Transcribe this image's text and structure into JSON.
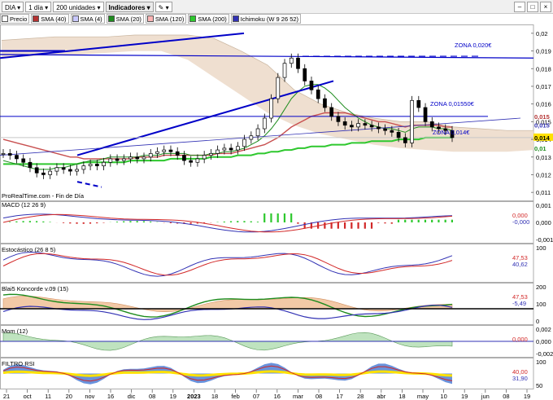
{
  "toolbar": {
    "symbol": "DIA",
    "period": "1 día",
    "units": "200 unidades",
    "indicators_label": "Indicadores"
  },
  "legend": [
    {
      "label": "Precio",
      "color": "#ffffff"
    },
    {
      "label": "SMA (40)",
      "color": "#b43232"
    },
    {
      "label": "SMA (4)",
      "color": "#c8c8ff"
    },
    {
      "label": "SMA (20)",
      "color": "#1e8c1e"
    },
    {
      "label": "SMA (120)",
      "color": "#ffb4b4"
    },
    {
      "label": "SMA (200)",
      "color": "#2ec82e"
    },
    {
      "label": "Ichimoku (W 9 26 52)",
      "color": "#3232b4"
    }
  ],
  "source_label": "ProRealTime.com - Fin de Día",
  "annotations": {
    "zone_020": "ZONA 0,020€",
    "zone_01550": "ZONA 0,01550€",
    "zone_014": "ZONA 0,014€"
  },
  "chart_data": {
    "type": "candlestick",
    "ylim": [
      0.0105,
      0.0205
    ],
    "y_ticks": [
      "0,02",
      "0,019",
      "0,018",
      "0,017",
      "0,016",
      "0,015",
      "0,014",
      "0,013",
      "0,012",
      "0,011"
    ],
    "right_labels": [
      {
        "text": "0,015",
        "value": 0.0153,
        "color": "#b43232"
      },
      {
        "text": "0,015",
        "value": 0.0148,
        "color": "#3232b4"
      },
      {
        "text": "0,014",
        "value": 0.0141,
        "color": "#000000",
        "bg": "#ffe100"
      },
      {
        "text": "0,01",
        "value": 0.0135,
        "color": "#1e8c1e"
      }
    ],
    "x_ticks": [
      "21",
      "oct",
      "11",
      "20",
      "nov",
      "16",
      "dic",
      "08",
      "19",
      "2023",
      "18",
      "feb",
      "07",
      "16",
      "mar",
      "08",
      "17",
      "28",
      "abr",
      "18",
      "may",
      "10",
      "19",
      "jun",
      "08",
      "19"
    ],
    "x_tick_bold": [
      "2023"
    ],
    "close_prices": [
      0.0132,
      0.0131,
      0.0129,
      0.0127,
      0.0124,
      0.0121,
      0.012,
      0.0122,
      0.0124,
      0.0123,
      0.0122,
      0.0123,
      0.0125,
      0.0126,
      0.0125,
      0.0127,
      0.0129,
      0.0128,
      0.0129,
      0.013,
      0.0129,
      0.013,
      0.0132,
      0.0133,
      0.0134,
      0.0133,
      0.0131,
      0.0128,
      0.0127,
      0.0129,
      0.0131,
      0.0132,
      0.0134,
      0.0135,
      0.0134,
      0.0136,
      0.014,
      0.0142,
      0.0146,
      0.0152,
      0.0163,
      0.0175,
      0.0183,
      0.0186,
      0.018,
      0.0173,
      0.0168,
      0.0163,
      0.0158,
      0.0153,
      0.015,
      0.0148,
      0.0147,
      0.0149,
      0.0148,
      0.0147,
      0.0146,
      0.0145,
      0.0144,
      0.0141,
      0.0138,
      0.0162,
      0.0158,
      0.015,
      0.0147,
      0.0146,
      0.0145,
      0.0141
    ],
    "sma20": [
      0.0128,
      0.0127,
      0.0126,
      0.0125,
      0.0124,
      0.0123,
      0.0123,
      0.0123,
      0.0124,
      0.0124,
      0.0125,
      0.0126,
      0.0127,
      0.0128,
      0.0128,
      0.0129,
      0.013,
      0.013,
      0.013,
      0.013,
      0.013,
      0.0131,
      0.0131,
      0.0131,
      0.0132,
      0.0132,
      0.0132,
      0.0132,
      0.0131,
      0.0131,
      0.0131,
      0.0132,
      0.0132,
      0.0133,
      0.0133,
      0.0134,
      0.0135,
      0.0137,
      0.0139,
      0.0142,
      0.0146,
      0.0151,
      0.0157,
      0.0163,
      0.0167,
      0.017,
      0.0171,
      0.0171,
      0.0169,
      0.0166,
      0.0162,
      0.0158,
      0.0155,
      0.0152,
      0.015,
      0.0148,
      0.0147,
      0.0146,
      0.0146,
      0.0145,
      0.0144,
      0.0146,
      0.0147,
      0.0147,
      0.0147,
      0.0146,
      0.0146,
      0.0145
    ],
    "sma40": [
      0.014,
      0.0139,
      0.0138,
      0.0137,
      0.0136,
      0.0135,
      0.0134,
      0.0133,
      0.0132,
      0.0131,
      0.013,
      0.013,
      0.0129,
      0.0129,
      0.0129,
      0.0129,
      0.0129,
      0.0129,
      0.0129,
      0.0129,
      0.013,
      0.013,
      0.013,
      0.013,
      0.0131,
      0.0131,
      0.0131,
      0.0131,
      0.0131,
      0.0131,
      0.0131,
      0.0131,
      0.0132,
      0.0132,
      0.0132,
      0.0133,
      0.0134,
      0.0135,
      0.0136,
      0.0137,
      0.0139,
      0.0141,
      0.0144,
      0.0147,
      0.0149,
      0.0151,
      0.0153,
      0.0154,
      0.0155,
      0.0155,
      0.0155,
      0.0155,
      0.0154,
      0.0153,
      0.0152,
      0.0151,
      0.015,
      0.015,
      0.0149,
      0.0148,
      0.0147,
      0.0148,
      0.0148,
      0.0148,
      0.0148,
      0.0148,
      0.0147,
      0.0147
    ],
    "sma200": [
      0.0126,
      0.0126,
      0.0126,
      0.0126,
      0.0126,
      0.0126,
      0.0126,
      0.0126,
      0.0126,
      0.0126,
      0.0126,
      0.0126,
      0.0127,
      0.0127,
      0.0127,
      0.0127,
      0.0127,
      0.0127,
      0.0127,
      0.0128,
      0.0128,
      0.0128,
      0.0128,
      0.0128,
      0.0128,
      0.0129,
      0.0129,
      0.0129,
      0.0129,
      0.0129,
      0.0129,
      0.013,
      0.013,
      0.013,
      0.013,
      0.0131,
      0.0131,
      0.0131,
      0.0132,
      0.0132,
      0.0133,
      0.0133,
      0.0134,
      0.0134,
      0.0135,
      0.0135,
      0.0136,
      0.0136,
      0.0136,
      0.0137,
      0.0137,
      0.0137,
      0.0138,
      0.0138,
      0.0138,
      0.0139,
      0.0139,
      0.0139,
      0.0139,
      0.014,
      0.014,
      0.014,
      0.014,
      0.0141,
      0.0141,
      0.0141,
      0.0141,
      0.0141
    ],
    "indicators": [
      {
        "name": "MACD (12 26 9)",
        "ticks": [
          "0,001",
          "0,000",
          "-0,001"
        ],
        "values_right": [
          "0,000",
          "-0,000"
        ]
      },
      {
        "name": "Estocástico (26 8 5)",
        "ticks": [
          "100"
        ],
        "values_right": [
          "47,53",
          "40,62"
        ]
      },
      {
        "name": "Blai5 Koncorde v.09 (15)",
        "ticks": [
          "200",
          "100",
          "0"
        ],
        "values_right": [
          "47,53",
          "-5,49"
        ]
      },
      {
        "name": "Mom (12)",
        "ticks": [
          "0,002",
          "0,000",
          "-0,002"
        ],
        "values_right": [
          "0,000"
        ]
      },
      {
        "name": "FILTRO RSI",
        "ticks": [
          "100",
          "50"
        ],
        "values_right": [
          "40,00",
          "31,90"
        ]
      }
    ]
  }
}
